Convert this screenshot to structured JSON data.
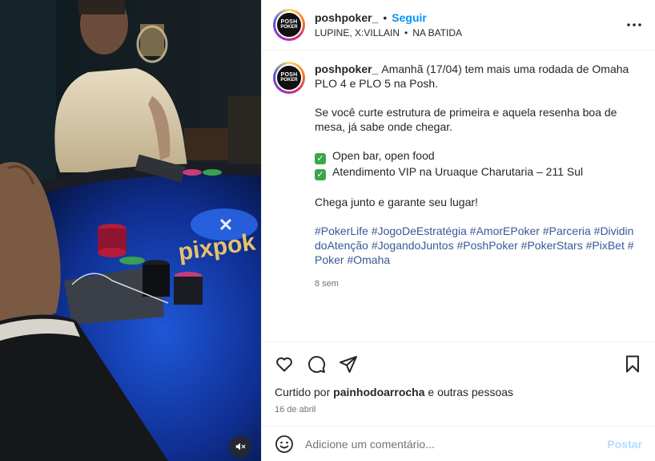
{
  "post": {
    "username": "poshpoker_",
    "dot": "•",
    "follow_label": "Seguir",
    "audio_left": "LUPINE, X:VILLAIN",
    "audio_sep": "•",
    "audio_right": "NA BATIDA",
    "avatar_line1": "POSH",
    "avatar_line2": "POKER"
  },
  "caption": {
    "username": "poshpoker_",
    "p1": "Amanhã (17/04) tem mais uma rodada de Omaha PLO 4 e PLO 5 na Posh.",
    "p2": "Se você curte estrutura de primeira e aquela resenha boa de mesa, já sabe onde chegar.",
    "bullet1": "Open bar, open food",
    "bullet2": "Atendimento VIP na Uruaque Charutaria – 211 Sul",
    "p4": "Chega junto e garante seu lugar!",
    "hashtags": [
      "#PokerLife",
      "#JogoDeEstratégia",
      "#AmorEPoker",
      "#Parceria",
      "#DividindoAtenção",
      "#JogandoJuntos",
      "#PoshPoker",
      "#PokerStars",
      "#PixBet",
      "#Poker",
      "#Omaha"
    ],
    "time": "8 sem",
    "check": "✓"
  },
  "likes": {
    "prefix": "Curtido por",
    "user": "painhodoarrocha",
    "suffix": "e outras pessoas"
  },
  "date": "16 de abril",
  "comment": {
    "placeholder": "Adicione um comentário...",
    "post_label": "Postar"
  },
  "media": {
    "table_text": "pixpok"
  },
  "icons": {
    "more": "more-icon",
    "like": "heart-icon",
    "comment": "comment-icon",
    "share": "share-icon",
    "save": "bookmark-icon",
    "emoji": "emoji-icon",
    "mute": "mute-icon"
  },
  "colors": {
    "follow": "#0095f6",
    "hashtag": "#385898",
    "post_disabled": "#b3dbff",
    "check": "#3aa64a"
  }
}
